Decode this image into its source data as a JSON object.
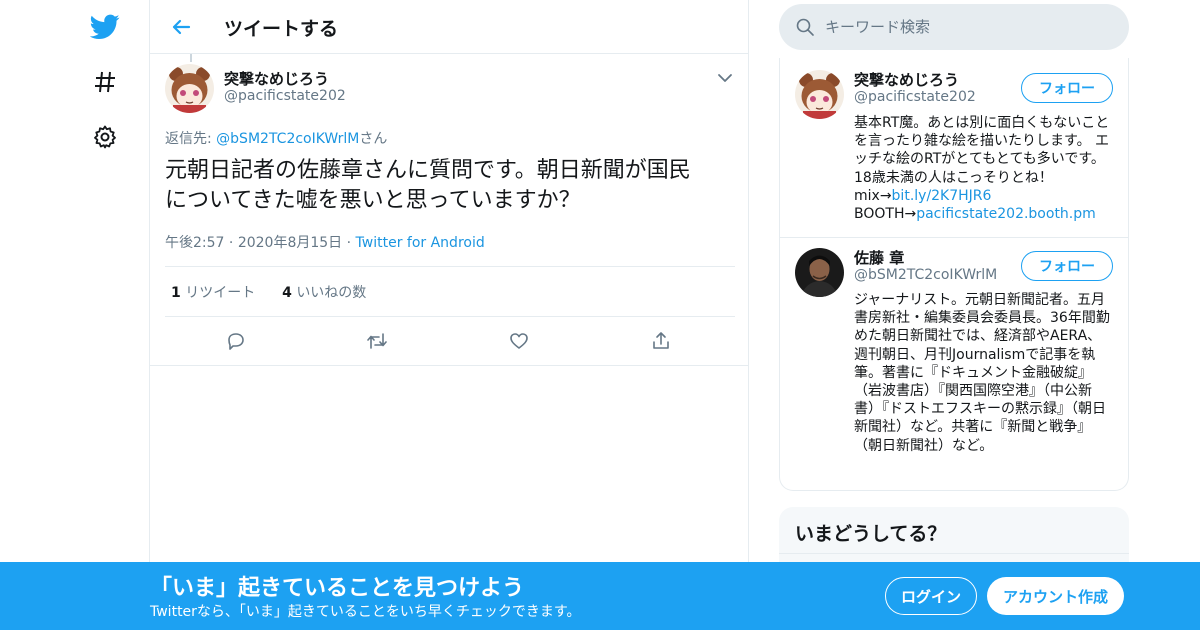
{
  "colors": {
    "accent": "#1da1f2",
    "link": "#1b95e0",
    "muted": "#657786",
    "border": "#e6ecf0",
    "text": "#14171a"
  },
  "nav": {
    "icons": [
      "twitter-logo-icon",
      "hashtag-icon",
      "gear-icon"
    ]
  },
  "header": {
    "title": "ツイートする"
  },
  "tweet": {
    "author_name": "突撃なめじろう",
    "author_handle": "@pacificstate202",
    "reply_prefix": "返信先: ",
    "reply_handle": "@bSM2TC2coIKWrlM",
    "reply_suffix": "さん",
    "text_line1": "元朝日記者の佐藤章さんに質問です。朝日新聞が国民",
    "text_line2": "についてきた嘘を悪いと思っていますか？",
    "time": "午後2:57",
    "date": "2020年8月15日",
    "source": "Twitter for Android",
    "retweet_count": "1",
    "retweet_label": "リツイート",
    "like_count": "4",
    "like_label": "いいねの数"
  },
  "search": {
    "placeholder": "キーワード検索"
  },
  "users": [
    {
      "name": "突撃なめじろう",
      "handle": "@pacificstate202",
      "follow_label": "フォロー",
      "bio_text": "基本RT魔。あとは別に面白くもないことを言ったり雑な絵を描いたりします。 エッチな絵のRTがとてもとても多いです。18歳未満の人はこっそりとね！ mix→",
      "bio_link1": "bit.ly/2K7HJR6",
      "bio_mid": "BOOTH→",
      "bio_link2": "pacificstate202.booth.pm"
    },
    {
      "name": "佐藤 章",
      "handle": "@bSM2TC2coIKWrlM",
      "follow_label": "フォロー",
      "bio_text": "ジャーナリスト。元朝日新聞記者。五月書房新社・編集委員会委員長。36年間勤めた朝日新聞社では、経済部やAERA、週刊朝日、月刊Journalismで記事を執筆。著書に『ドキュメント金融破綻』（岩波書店）『関西国際空港』（中公新書）『ドストエフスキーの黙示録』（朝日新聞社）など。共著に『新聞と戦争』（朝日新聞社）など。"
    }
  ],
  "trends": {
    "title": "いまどうしてる？"
  },
  "banner": {
    "title": "「いま」起きていることを見つけよう",
    "subtitle": "Twitterなら、「いま」起きていることをいち早くチェックできます。",
    "login_label": "ログイン",
    "signup_label": "アカウント作成"
  }
}
